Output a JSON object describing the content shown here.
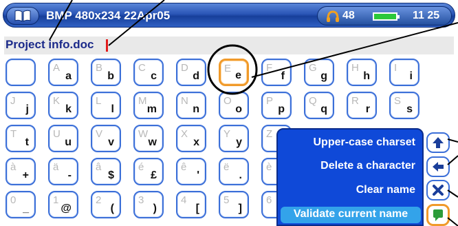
{
  "header": {
    "title": "BMP 480x234 22Apr05",
    "headphone_volume": "48",
    "clock": "11 25"
  },
  "filename": {
    "value": "Project info.doc"
  },
  "keyboard": {
    "rows": [
      [
        {
          "upper": "",
          "lower": ""
        },
        {
          "upper": "A",
          "lower": "a"
        },
        {
          "upper": "B",
          "lower": "b"
        },
        {
          "upper": "C",
          "lower": "c"
        },
        {
          "upper": "D",
          "lower": "d"
        },
        {
          "upper": "E",
          "lower": "e",
          "selected": true
        },
        {
          "upper": "F",
          "lower": "f"
        },
        {
          "upper": "G",
          "lower": "g"
        },
        {
          "upper": "H",
          "lower": "h"
        },
        {
          "upper": "I",
          "lower": "i"
        }
      ],
      [
        {
          "upper": "J",
          "lower": "j"
        },
        {
          "upper": "K",
          "lower": "k"
        },
        {
          "upper": "L",
          "lower": "l"
        },
        {
          "upper": "M",
          "lower": "m"
        },
        {
          "upper": "N",
          "lower": "n"
        },
        {
          "upper": "O",
          "lower": "o"
        },
        {
          "upper": "P",
          "lower": "p"
        },
        {
          "upper": "Q",
          "lower": "q"
        },
        {
          "upper": "R",
          "lower": "r"
        },
        {
          "upper": "S",
          "lower": "s"
        }
      ],
      [
        {
          "upper": "T",
          "lower": "t"
        },
        {
          "upper": "U",
          "lower": "u"
        },
        {
          "upper": "V",
          "lower": "v"
        },
        {
          "upper": "W",
          "lower": "w"
        },
        {
          "upper": "X",
          "lower": "x"
        },
        {
          "upper": "Y",
          "lower": "y"
        },
        {
          "upper": "Z",
          "lower": ""
        }
      ],
      [
        {
          "upper": "à",
          "lower": "+"
        },
        {
          "upper": "ä",
          "lower": "-"
        },
        {
          "upper": "â",
          "lower": "$"
        },
        {
          "upper": "é",
          "lower": "£"
        },
        {
          "upper": "ê",
          "lower": "'"
        },
        {
          "upper": "ë",
          "lower": "."
        },
        {
          "upper": "è",
          "lower": ""
        }
      ],
      [
        {
          "upper": "0",
          "lower": "_"
        },
        {
          "upper": "1",
          "lower": "@"
        },
        {
          "upper": "2",
          "lower": "("
        },
        {
          "upper": "3",
          "lower": ")"
        },
        {
          "upper": "4",
          "lower": "["
        },
        {
          "upper": "5",
          "lower": "]"
        },
        {
          "upper": "6",
          "lower": ""
        }
      ]
    ]
  },
  "menu": {
    "items": [
      {
        "label": "Upper-case charset"
      },
      {
        "label": "Delete a character"
      },
      {
        "label": "Clear name"
      },
      {
        "label": "Validate current name",
        "highlighted": true
      }
    ]
  },
  "side_buttons": [
    {
      "icon": "shift-up-arrow-icon"
    },
    {
      "icon": "backspace-arrow-icon"
    },
    {
      "icon": "clear-x-icon"
    },
    {
      "icon": "validate-icon"
    }
  ],
  "colors": {
    "titlebar_blue": "#2a55b6",
    "key_border": "#3b6fd8",
    "selected_border": "#f09a2a",
    "menu_bg": "#0f49d8",
    "menu_highlight": "#33a3ea",
    "caret": "#e21b1b",
    "filename_text": "#1b2a8a"
  }
}
